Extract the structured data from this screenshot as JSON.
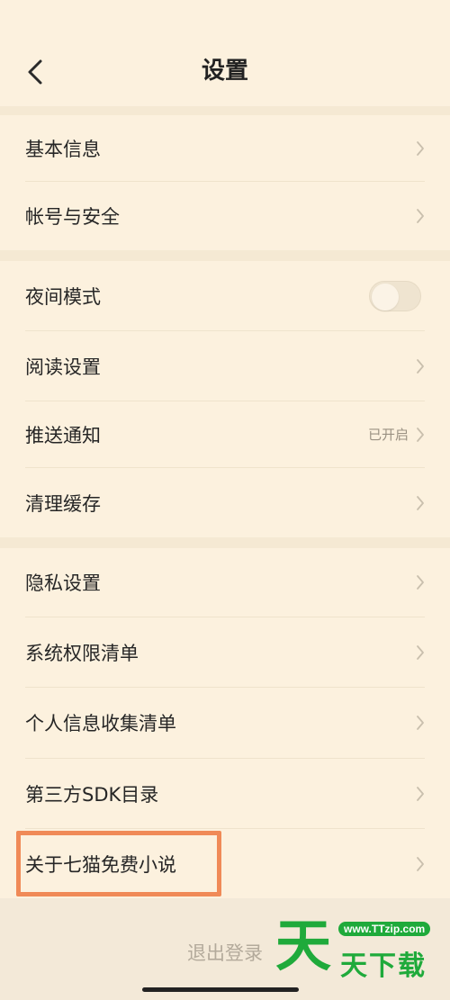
{
  "header": {
    "title": "设置",
    "back_icon": "chevron-left-icon"
  },
  "groups": [
    {
      "items": [
        {
          "label": "基本信息",
          "type": "link"
        },
        {
          "label": "帐号与安全",
          "type": "link"
        }
      ]
    },
    {
      "items": [
        {
          "label": "夜间模式",
          "type": "toggle",
          "on": false
        },
        {
          "label": "阅读设置",
          "type": "link"
        },
        {
          "label": "推送通知",
          "type": "link",
          "value": "已开启"
        },
        {
          "label": "清理缓存",
          "type": "link"
        }
      ]
    },
    {
      "items": [
        {
          "label": "隐私设置",
          "type": "link"
        },
        {
          "label": "系统权限清单",
          "type": "link"
        },
        {
          "label": "个人信息收集清单",
          "type": "link"
        },
        {
          "label": "第三方SDK目录",
          "type": "link"
        },
        {
          "label": "关于七猫免费小说",
          "type": "link",
          "highlighted": true
        }
      ]
    }
  ],
  "logout_label": "退出登录",
  "watermark": {
    "big": "天",
    "text": "天下载",
    "url": "www.TTzip.com"
  },
  "colors": {
    "background": "#fcf1de",
    "highlight": "#f08a57",
    "watermark": "#1faa3b"
  }
}
